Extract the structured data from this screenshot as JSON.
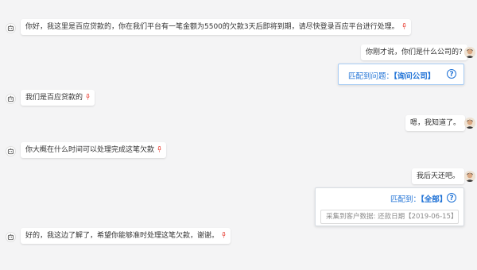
{
  "messages": [
    {
      "role": "bot",
      "text": "你好，我这里是百应贷款的，你在我们平台有一笔金额为5500的欠款3天后即将到期，请尽快登录百应平台进行处理。"
    },
    {
      "role": "user",
      "text": "你刚才说，你们是什么公司的?"
    },
    {
      "role": "bot",
      "text": "我们是百应贷款的"
    },
    {
      "role": "user",
      "text": "嗯，我知道了。"
    },
    {
      "role": "bot",
      "text": "你大概在什么时间可以处理完成这笔欠款"
    },
    {
      "role": "user",
      "text": "我后天还吧。"
    },
    {
      "role": "bot",
      "text": "好的，我这边了解了，希望你能够准时处理这笔欠款，谢谢。"
    }
  ],
  "match1": {
    "label": "匹配到问题：",
    "value": "【询问公司】",
    "help_icon": "question-circle-icon"
  },
  "match2": {
    "label": "匹配到：",
    "value": "【全部】",
    "help_icon": "question-circle-icon",
    "collected": "采集到客户数据: 还款日期【2019-06-15】"
  },
  "icons": {
    "bot": "robot-icon",
    "user": "user-avatar",
    "voice": "microphone-icon"
  },
  "colors": {
    "accent": "#1f72d6",
    "mic": "#e8473d",
    "match_border": "#a9cdf4",
    "background": "#f4f4f5"
  }
}
